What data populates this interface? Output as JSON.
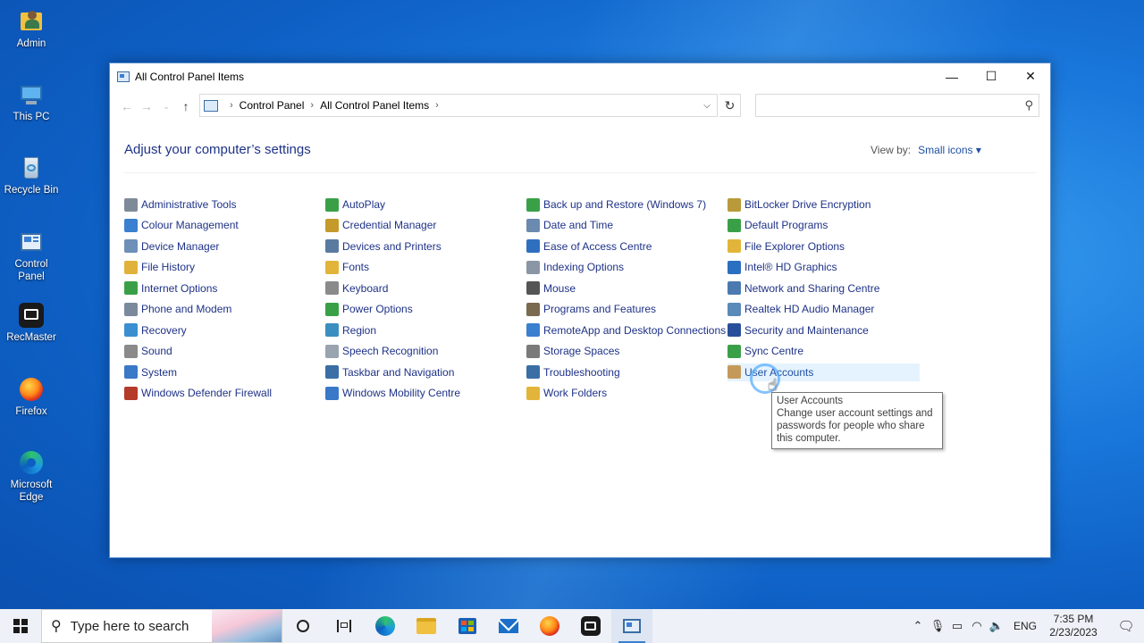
{
  "desktop": {
    "icons": [
      {
        "label": "Admin",
        "icon": "user-folder-icon"
      },
      {
        "label": "This PC",
        "icon": "computer-icon"
      },
      {
        "label": "Recycle Bin",
        "icon": "recycle-bin-icon"
      },
      {
        "label": "Control Panel",
        "icon": "control-panel-icon"
      },
      {
        "label": "RecMaster",
        "icon": "recmaster-icon"
      },
      {
        "label": "Firefox",
        "icon": "firefox-icon"
      },
      {
        "label": "Microsoft Edge",
        "icon": "edge-icon"
      }
    ]
  },
  "window": {
    "title": "All Control Panel Items",
    "controls": {
      "minimize": "—",
      "maximize": "☐",
      "close": "✕"
    },
    "address": {
      "crumbs": [
        "Control Panel",
        "All Control Panel Items"
      ],
      "search_placeholder": ""
    },
    "heading": "Adjust your computer’s settings",
    "view_by": {
      "label": "View by:",
      "value": "Small icons ▾"
    },
    "columns": [
      [
        {
          "label": "Administrative Tools",
          "color": "#7f8a99"
        },
        {
          "label": "Colour Management",
          "color": "#3b7fd0"
        },
        {
          "label": "Device Manager",
          "color": "#6d8fb8"
        },
        {
          "label": "File History",
          "color": "#e0b23a"
        },
        {
          "label": "Internet Options",
          "color": "#3aa048"
        },
        {
          "label": "Phone and Modem",
          "color": "#7a8a9c"
        },
        {
          "label": "Recovery",
          "color": "#3a8fd0"
        },
        {
          "label": "Sound",
          "color": "#8a8a8a"
        },
        {
          "label": "System",
          "color": "#3a78c8"
        },
        {
          "label": "Windows Defender Firewall",
          "color": "#b43a2a"
        }
      ],
      [
        {
          "label": "AutoPlay",
          "color": "#3aa048"
        },
        {
          "label": "Credential Manager",
          "color": "#c49a2a"
        },
        {
          "label": "Devices and Printers",
          "color": "#5a7aa0"
        },
        {
          "label": "Fonts",
          "color": "#e2b53a"
        },
        {
          "label": "Keyboard",
          "color": "#8a8a8a"
        },
        {
          "label": "Power Options",
          "color": "#3aa048"
        },
        {
          "label": "Region",
          "color": "#3a8fc0"
        },
        {
          "label": "Speech Recognition",
          "color": "#9aa4b0"
        },
        {
          "label": "Taskbar and Navigation",
          "color": "#3a6ea5"
        },
        {
          "label": "Windows Mobility Centre",
          "color": "#3a78c8"
        }
      ],
      [
        {
          "label": "Back up and Restore (Windows 7)",
          "color": "#3aa048"
        },
        {
          "label": "Date and Time",
          "color": "#6a8ab0"
        },
        {
          "label": "Ease of Access Centre",
          "color": "#2f6fc0"
        },
        {
          "label": "Indexing Options",
          "color": "#8a96a6"
        },
        {
          "label": "Mouse",
          "color": "#555555"
        },
        {
          "label": "Programs and Features",
          "color": "#7a6a50"
        },
        {
          "label": "RemoteApp and Desktop Connections",
          "color": "#3a7fd0"
        },
        {
          "label": "Storage Spaces",
          "color": "#7a7a7a"
        },
        {
          "label": "Troubleshooting",
          "color": "#3a6ea5"
        },
        {
          "label": "Work Folders",
          "color": "#e2b53a"
        }
      ],
      [
        {
          "label": "BitLocker Drive Encryption",
          "color": "#b89a3a"
        },
        {
          "label": "Default Programs",
          "color": "#3aa048"
        },
        {
          "label": "File Explorer Options",
          "color": "#e2b53a"
        },
        {
          "label": "Intel® HD Graphics",
          "color": "#2a6fc0"
        },
        {
          "label": "Network and Sharing Centre",
          "color": "#4a7ab0"
        },
        {
          "label": "Realtek HD Audio Manager",
          "color": "#5a8ab8"
        },
        {
          "label": "Security and Maintenance",
          "color": "#2a4f9a"
        },
        {
          "label": "Sync Centre",
          "color": "#3aa048"
        },
        {
          "label": "User Accounts",
          "color": "#c49a5a"
        }
      ]
    ],
    "hovered_item": "User Accounts",
    "tooltip": {
      "title": "User Accounts",
      "text": "Change user account settings and passwords for people who share this computer."
    }
  },
  "taskbar": {
    "search_placeholder": "Type here to search",
    "apps": [
      {
        "name": "task-view-icon"
      },
      {
        "name": "timeline-icon"
      },
      {
        "name": "edge-icon"
      },
      {
        "name": "file-explorer-icon"
      },
      {
        "name": "store-icon"
      },
      {
        "name": "mail-icon"
      },
      {
        "name": "firefox-icon"
      },
      {
        "name": "recmaster-icon"
      },
      {
        "name": "control-panel-icon"
      }
    ],
    "tray": {
      "language": "ENG",
      "time": "7:35 PM",
      "date": "2/23/2023"
    }
  }
}
